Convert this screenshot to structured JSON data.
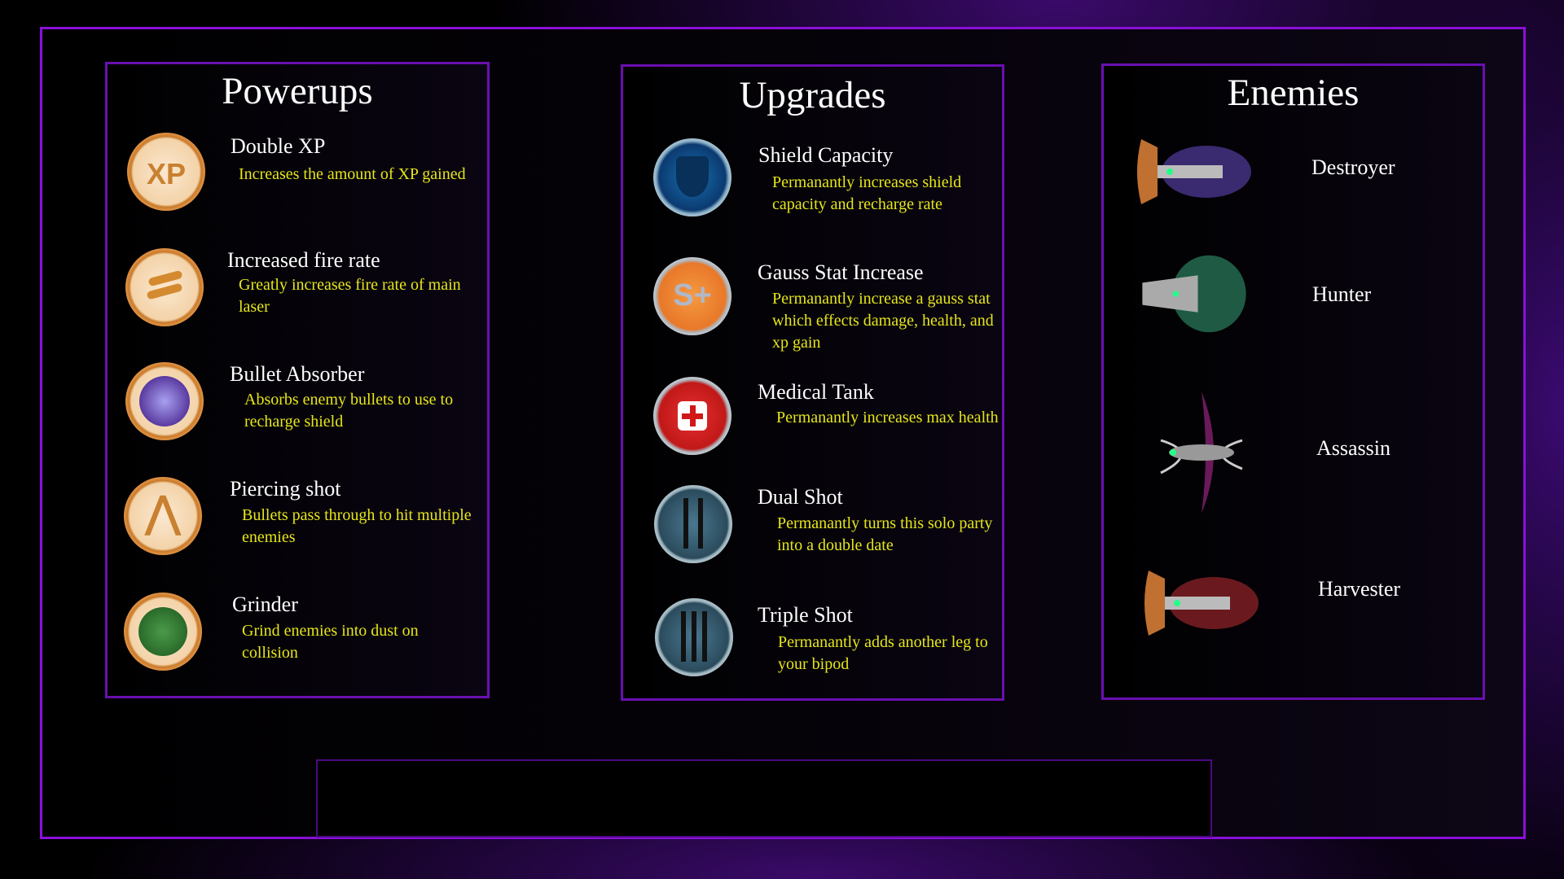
{
  "powerups": {
    "title": "Powerups",
    "items": [
      {
        "name": "Double XP",
        "desc": "Increases the amount of XP gained",
        "icon": "double-xp-icon"
      },
      {
        "name": "Increased fire rate",
        "desc": "Greatly increases fire rate of main laser",
        "icon": "fire-rate-icon"
      },
      {
        "name": "Bullet Absorber",
        "desc": "Absorbs enemy bullets to use to recharge shield",
        "icon": "bullet-absorber-icon"
      },
      {
        "name": "Piercing shot",
        "desc": "Bullets pass through to hit multiple enemies",
        "icon": "piercing-shot-icon"
      },
      {
        "name": "Grinder",
        "desc": "Grind enemies into dust on collision",
        "icon": "grinder-icon"
      }
    ]
  },
  "upgrades": {
    "title": "Upgrades",
    "items": [
      {
        "name": "Shield Capacity",
        "desc": "Permanantly increases shield capacity and recharge rate",
        "icon": "shield-icon"
      },
      {
        "name": "Gauss Stat Increase",
        "desc": "Permanantly increase a gauss stat which effects damage, health, and xp gain",
        "icon": "stat-plus-icon",
        "icon_text": "S+"
      },
      {
        "name": "Medical Tank",
        "desc": "Permanantly increases max health",
        "icon": "medical-cross-icon"
      },
      {
        "name": "Dual Shot",
        "desc": "Permanantly turns this solo party into a double date",
        "icon": "dual-cannon-icon"
      },
      {
        "name": "Triple Shot",
        "desc": "Permanantly adds another leg to your bipod",
        "icon": "triple-cannon-icon"
      }
    ]
  },
  "enemies": {
    "title": "Enemies",
    "items": [
      {
        "name": "Destroyer",
        "color": "#3a2a70"
      },
      {
        "name": "Hunter",
        "color": "#1e5a44"
      },
      {
        "name": "Assassin",
        "color": "#6a1a5a"
      },
      {
        "name": "Harvester",
        "color": "#6a1a1e"
      }
    ]
  },
  "colors": {
    "border": "#8a10d8",
    "desc": "#e6e61a"
  }
}
